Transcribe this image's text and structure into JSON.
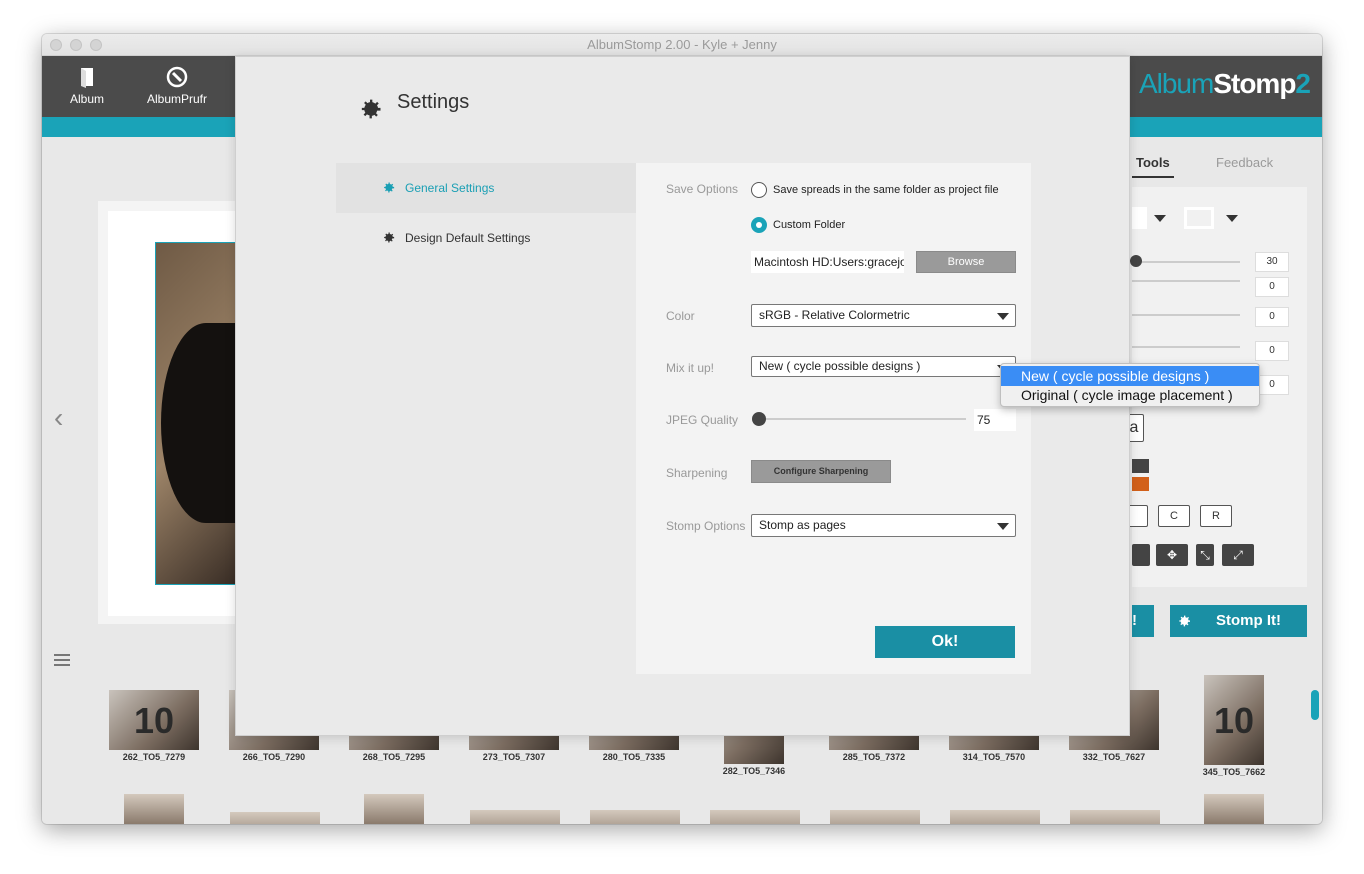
{
  "window": {
    "title": "AlbumStomp 2.00 - Kyle + Jenny"
  },
  "topnav": {
    "album_label": "Album",
    "albumprufr_label": "AlbumPrufr"
  },
  "logo": {
    "part1": "Album",
    "part2": "Stomp",
    "part3": "2"
  },
  "right_panel": {
    "tabs": {
      "tools": "Tools",
      "feedback": "Feedback"
    },
    "values": [
      "30",
      "0",
      "0",
      "0",
      "0"
    ],
    "letter_a": "a",
    "align_c": "C",
    "align_r": "R",
    "stomp_label": "Stomp It!",
    "partial_button": "!"
  },
  "modal": {
    "title": "Settings",
    "sidebar": {
      "general": "General Settings",
      "design_default": "Design Default Settings"
    },
    "save_options": {
      "label": "Save Options",
      "option_same_folder": "Save spreads in the same folder as project file",
      "option_custom": "Custom Folder",
      "folder_path": "Macintosh HD:Users:gracejo",
      "browse": "Browse"
    },
    "color": {
      "label": "Color",
      "value": "sRGB - Relative Colormetric"
    },
    "mix": {
      "label": "Mix it up!",
      "value": "New ( cycle possible designs )"
    },
    "jpeg": {
      "label": "JPEG Quality",
      "value": "75"
    },
    "sharpening": {
      "label": "Sharpening",
      "button": "Configure Sharpening"
    },
    "stomp_options": {
      "label": "Stomp Options",
      "value": "Stomp as pages"
    },
    "ok": "Ok!"
  },
  "dropdown": {
    "options": [
      "New ( cycle possible designs )",
      "Original ( cycle image placement )"
    ],
    "selected_index": 0
  },
  "thumbnails": {
    "row1": [
      {
        "label": "262_TO5_7279",
        "num": "10"
      },
      {
        "label": "266_TO5_7290",
        "num": ""
      },
      {
        "label": "268_TO5_7295",
        "num": ""
      },
      {
        "label": "273_TO5_7307",
        "num": ""
      },
      {
        "label": "280_TO5_7335",
        "num": ""
      },
      {
        "label": "282_TO5_7346",
        "num": ""
      },
      {
        "label": "285_TO5_7372",
        "num": ""
      },
      {
        "label": "314_TO5_7570",
        "num": ""
      },
      {
        "label": "332_TO5_7627",
        "num": ""
      },
      {
        "label": "345_TO5_7662",
        "num": "10"
      }
    ]
  },
  "colors": {
    "accent": "#1aa3b8",
    "button": "#1a8fa4",
    "topbar": "#4b4b4b",
    "selection": "#3a8df5"
  }
}
